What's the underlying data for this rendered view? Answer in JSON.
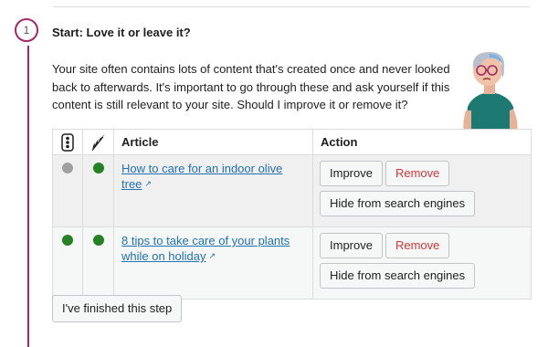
{
  "step": {
    "number": "1",
    "title": "Start: Love it or leave it?",
    "description": "Your site often contains lots of content that's created once and never looked back to afterwards. It's important to go through these and ask yourself if this content is still relevant to your site. Should I improve it or remove it?"
  },
  "table": {
    "icon_columns": [
      "readability-icon",
      "seo-icon"
    ],
    "headers": {
      "article": "Article",
      "action": "Action"
    },
    "rows": [
      {
        "readability_status": "gray",
        "seo_status": "green",
        "article": "How to care for an indoor olive tree",
        "improve_label": "Improve",
        "remove_label": "Remove",
        "hide_label": "Hide from search engines"
      },
      {
        "readability_status": "green",
        "seo_status": "green",
        "article": "8 tips to take care of your plants while on holiday",
        "improve_label": "Improve",
        "remove_label": "Remove",
        "hide_label": "Hide from search engines"
      }
    ]
  },
  "finish_label": "I've finished this step",
  "colors": {
    "timeline": "#a4286a",
    "status_green": "#238223",
    "status_gray": "#a0a0a0",
    "link": "#2271b1",
    "remove": "#d63638"
  }
}
